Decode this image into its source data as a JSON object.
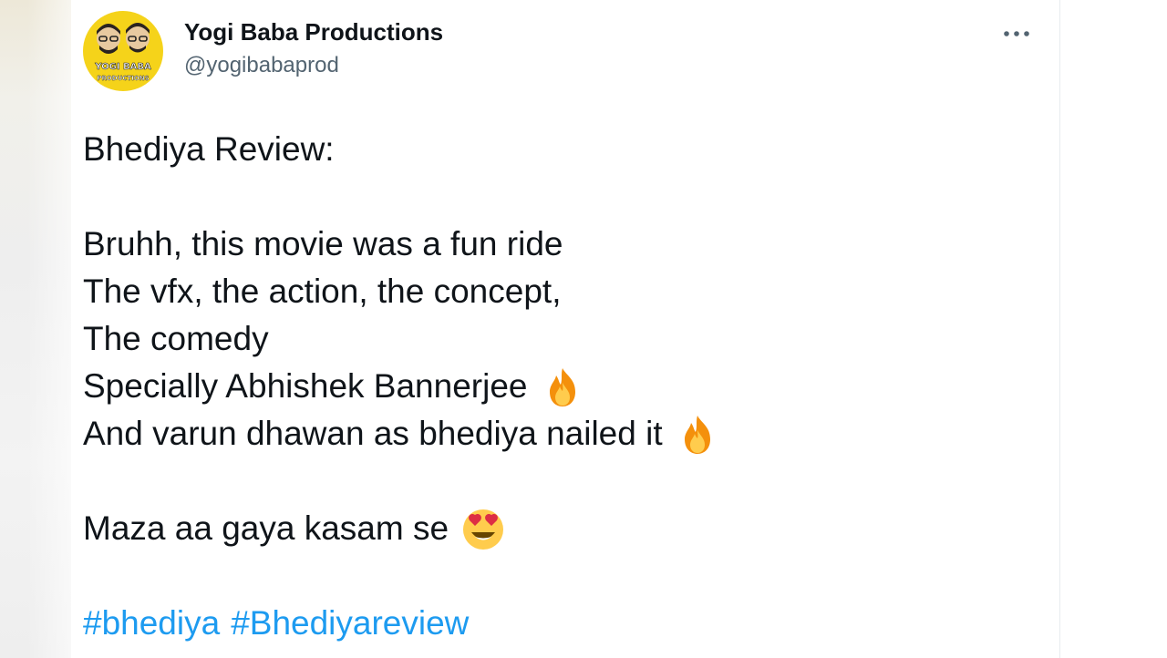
{
  "tweet": {
    "author": {
      "display_name": "Yogi Baba Productions",
      "handle": "@yogibabaprod",
      "avatar_text": "YOGI BABA"
    },
    "more_icon": "more-horizontal-icon",
    "lines": [
      "Bhediya Review:",
      "",
      "Bruhh, this movie was a fun ride",
      "The vfx, the action, the concept,",
      "The comedy",
      "Specially Abhishek Bannerjee",
      "And varun dhawan as bhediya nailed it",
      "",
      "Maza aa gaya kasam se"
    ],
    "emojis": {
      "abhishek_line": "fire-emoji",
      "varun_line": "fire-emoji",
      "maza_line": "heart-eyes-emoji"
    },
    "hashtags": [
      "#bhediya",
      "#Bhediyareview"
    ]
  },
  "colors": {
    "text": "#0f1419",
    "secondary": "#536471",
    "link": "#1d9bf0",
    "avatar_bg": "#f5d31a"
  }
}
